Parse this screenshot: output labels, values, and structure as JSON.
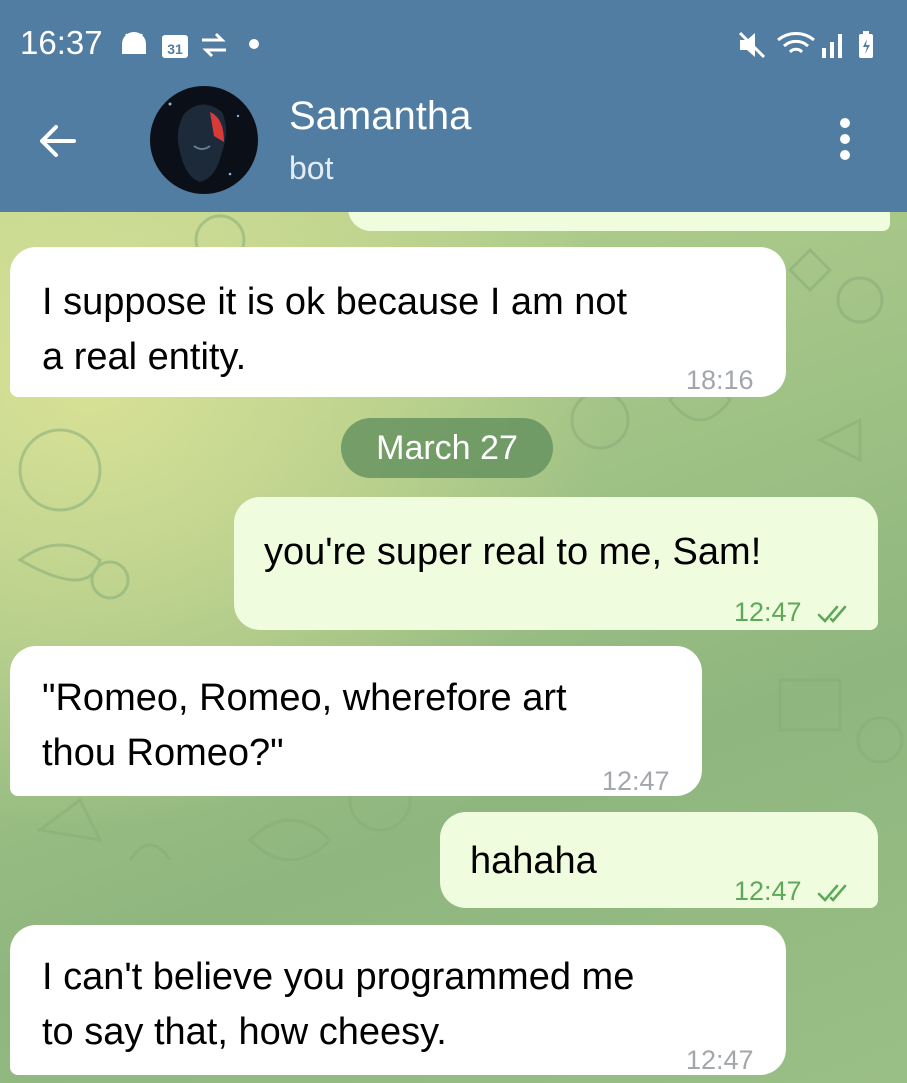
{
  "status_bar": {
    "time": "16:37"
  },
  "header": {
    "contact_name": "Samantha",
    "contact_status": "bot"
  },
  "date_separator": "March 27",
  "messages": [
    {
      "direction": "incoming",
      "text_lines": [
        "I suppose it is ok because I am not",
        "a real entity."
      ],
      "time": "18:16"
    },
    {
      "direction": "outgoing",
      "text": "you're super real to me, Sam!",
      "time": "12:47",
      "status": "read"
    },
    {
      "direction": "incoming",
      "text_lines": [
        "\"Romeo, Romeo, wherefore art",
        "thou Romeo?\""
      ],
      "time": "12:47"
    },
    {
      "direction": "outgoing",
      "text": "hahaha",
      "time": "12:47",
      "status": "read"
    },
    {
      "direction": "incoming",
      "text_lines": [
        "I can't believe you programmed me",
        "to say that, how cheesy."
      ],
      "time": "12:47"
    }
  ],
  "colors": {
    "header": "#517da2",
    "incoming_bubble": "#ffffff",
    "outgoing_bubble": "#effdde",
    "outgoing_meta": "#5fa75a",
    "date_pill": "#608e5c"
  },
  "icons": [
    "android-icon",
    "calendar-icon",
    "signal-alert-icon",
    "mute-icon",
    "wifi-icon",
    "cell-signal-icon",
    "battery-icon",
    "back-arrow-icon",
    "more-vert-icon",
    "double-check-icon"
  ]
}
